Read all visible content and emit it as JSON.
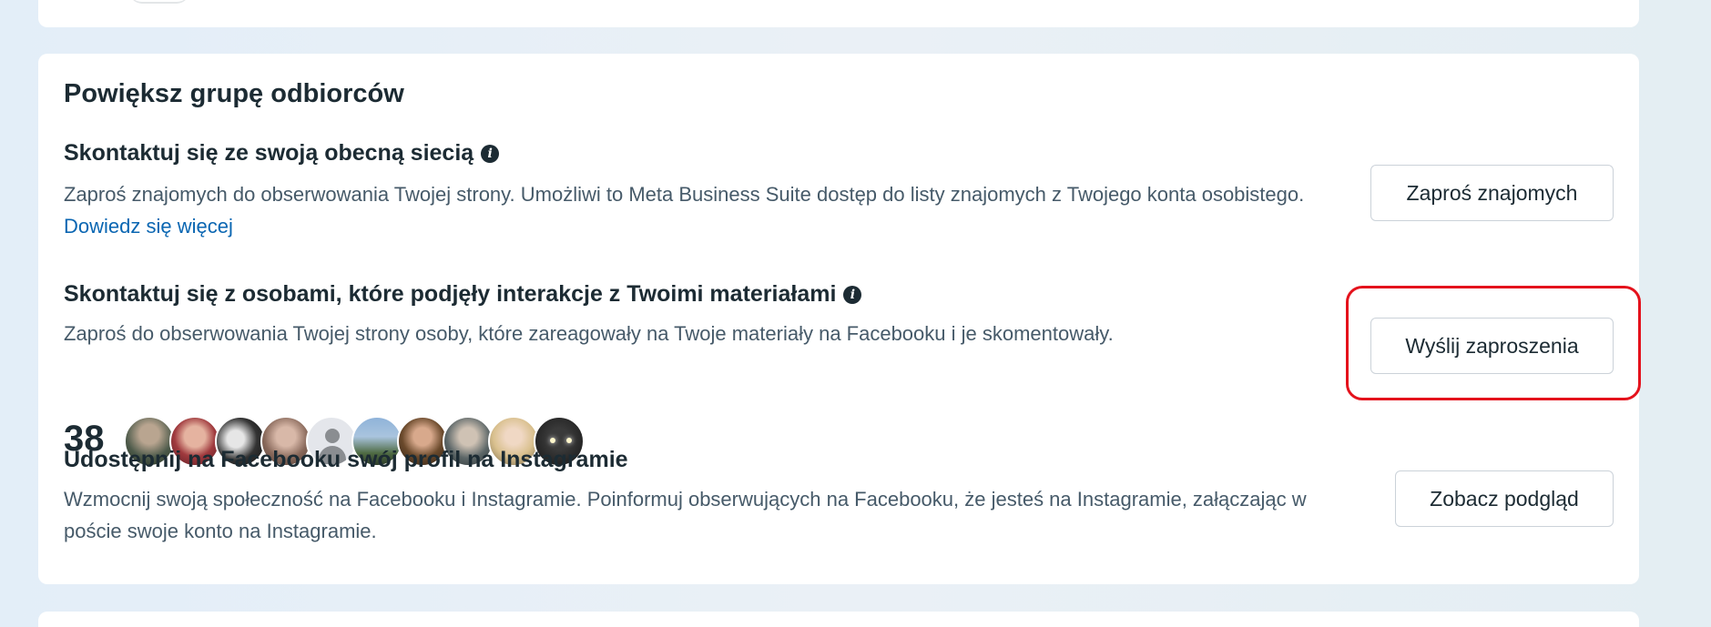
{
  "section": {
    "title": "Powiększ grupę odbiorców"
  },
  "rows": [
    {
      "title": "Skontaktuj się ze swoją obecną siecią",
      "description": "Zaproś znajomych do obserwowania Twojej strony. Umożliwi to Meta Business Suite dostęp do listy znajomych z Twojego konta osobistego.",
      "link": "Dowiedz się więcej",
      "button": "Zaproś znajomych"
    },
    {
      "title": "Skontaktuj się z osobami, które podjęły interakcje z Twoimi materiałami",
      "description": "Zaproś do obserwowania Twojej strony osoby, które zareagowały na Twoje materiały na Facebooku i je skomentowały.",
      "count": "38",
      "button": "Wyślij zaproszenia"
    },
    {
      "title": "Udostępnij na Facebooku swój profil na Instagramie",
      "description": "Wzmocnij swoją społeczność na Facebooku i Instagramie. Poinformuj obserwujących na Facebooku, że jesteś na Instagramie, załączając w poście swoje konto na Instagramie.",
      "button": "Zobacz podgląd"
    }
  ],
  "icons": {
    "info": "info-icon"
  },
  "colors": {
    "link": "#0a66b2",
    "highlight": "#e4121c",
    "text": "#1c2b33",
    "secondary_text": "#465a69"
  }
}
